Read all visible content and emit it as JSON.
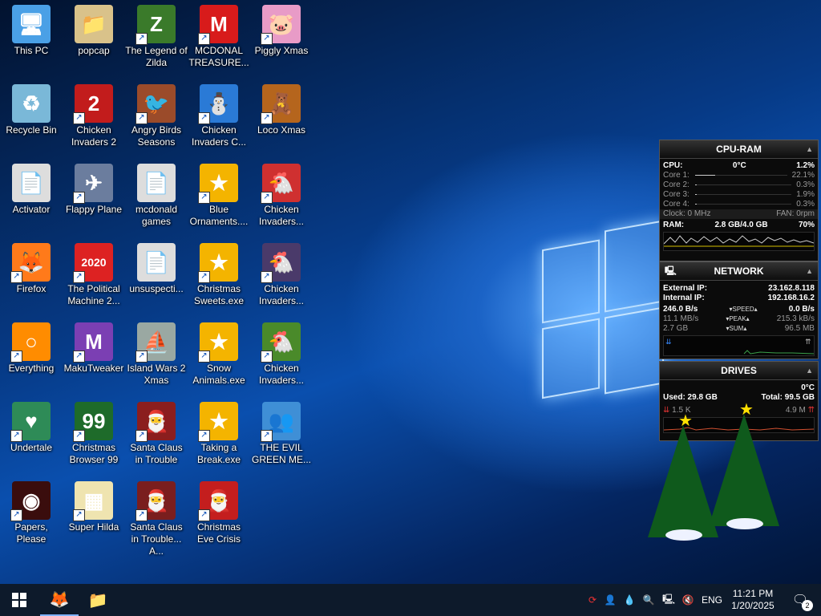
{
  "desktop_icons": [
    {
      "label": "This PC",
      "glyph": "🖥",
      "bg": "#4aa0e6",
      "shortcut": false
    },
    {
      "label": "popcap",
      "glyph": "📁",
      "bg": "#d9c28a",
      "shortcut": false
    },
    {
      "label": "The Legend of Zilda",
      "glyph": "Z",
      "bg": "#3a7a2a",
      "shortcut": true
    },
    {
      "label": "MCDONAL TREASURE...",
      "glyph": "M",
      "bg": "#d81b1b",
      "shortcut": true
    },
    {
      "label": "Piggly Xmas",
      "glyph": "🐷",
      "bg": "#e89bc7",
      "shortcut": true
    },
    {
      "label": "Recycle Bin",
      "glyph": "♻",
      "bg": "#7ab8d8",
      "shortcut": false
    },
    {
      "label": "Chicken Invaders 2",
      "glyph": "2",
      "bg": "#c21c1c",
      "shortcut": true
    },
    {
      "label": "Angry Birds Seasons",
      "glyph": "🐦",
      "bg": "#9b4b2a",
      "shortcut": true
    },
    {
      "label": "Chicken Invaders C...",
      "glyph": "⛄",
      "bg": "#2a7ad6",
      "shortcut": true
    },
    {
      "label": "Loco Xmas",
      "glyph": "🧸",
      "bg": "#b5651d",
      "shortcut": true
    },
    {
      "label": "Activator",
      "glyph": "📄",
      "bg": "#dddddd",
      "shortcut": false
    },
    {
      "label": "Flappy Plane",
      "glyph": "✈",
      "bg": "#6b7d9e",
      "shortcut": true
    },
    {
      "label": "mcdonald games",
      "glyph": "📄",
      "bg": "#dddddd",
      "shortcut": false
    },
    {
      "label": "Blue Ornaments....",
      "glyph": "★",
      "bg": "#f4b400",
      "shortcut": true
    },
    {
      "label": "Chicken Invaders...",
      "glyph": "🐔",
      "bg": "#cf3030",
      "shortcut": true
    },
    {
      "label": "Firefox",
      "glyph": "🦊",
      "bg": "#ff7a1a",
      "shortcut": true
    },
    {
      "label": "The Political Machine 2...",
      "glyph": "2020",
      "bg": "#d22",
      "shortcut": true
    },
    {
      "label": "unsuspecti...",
      "glyph": "📄",
      "bg": "#dddddd",
      "shortcut": false
    },
    {
      "label": "Christmas Sweets.exe",
      "glyph": "★",
      "bg": "#f4b400",
      "shortcut": true
    },
    {
      "label": "Chicken Invaders...",
      "glyph": "🐔",
      "bg": "#4a3a6a",
      "shortcut": true
    },
    {
      "label": "Everything",
      "glyph": "○",
      "bg": "#ff8c00",
      "shortcut": true
    },
    {
      "label": "MakuTweaker",
      "glyph": "M",
      "bg": "#7b3fb3",
      "shortcut": true
    },
    {
      "label": "Island Wars 2 Xmas",
      "glyph": "⛵",
      "bg": "#9aa8a2",
      "shortcut": true
    },
    {
      "label": "Snow Animals.exe",
      "glyph": "★",
      "bg": "#f4b400",
      "shortcut": true
    },
    {
      "label": "Chicken Invaders...",
      "glyph": "🐔",
      "bg": "#4a8a2a",
      "shortcut": true
    },
    {
      "label": "Undertale",
      "glyph": "♥",
      "bg": "#2e8b57",
      "shortcut": true
    },
    {
      "label": "Christmas Browser 99",
      "glyph": "99",
      "bg": "#1e6b2a",
      "shortcut": true
    },
    {
      "label": "Santa Claus in Trouble",
      "glyph": "🎅",
      "bg": "#8b1e1e",
      "shortcut": true
    },
    {
      "label": "Taking a Break.exe",
      "glyph": "★",
      "bg": "#f4b400",
      "shortcut": true
    },
    {
      "label": "THE EVIL GREEN ME...",
      "glyph": "👥",
      "bg": "#3f8fd6",
      "shortcut": true
    },
    {
      "label": "Papers, Please",
      "glyph": "◉",
      "bg": "#3a0d0d",
      "shortcut": true
    },
    {
      "label": "Super Hilda",
      "glyph": "▦",
      "bg": "#efe4b0",
      "shortcut": true
    },
    {
      "label": "Santa Claus in Trouble... A...",
      "glyph": "🎅",
      "bg": "#7a1e1e",
      "shortcut": true
    },
    {
      "label": "Christmas Eve Crisis",
      "glyph": "🎅",
      "bg": "#c41e1e",
      "shortcut": true
    }
  ],
  "cpu_gadget": {
    "title": "CPU-RAM",
    "cpu_label": "CPU:",
    "cpu_temp": "0°C",
    "cpu_usage": "1.2%",
    "cores": [
      {
        "label": "Core 1:",
        "value": "22.1%",
        "level": 0.22
      },
      {
        "label": "Core 2:",
        "value": "0.3%",
        "level": 0.003
      },
      {
        "label": "Core 3:",
        "value": "1.9%",
        "level": 0.02
      },
      {
        "label": "Core 4:",
        "value": "0.3%",
        "level": 0.003
      }
    ],
    "clock": "Clock: 0 MHz",
    "fan": "FAN: 0rpm",
    "ram_label": "RAM:",
    "ram_used": "2.8 GB/4.0 GB",
    "ram_pct": "70%"
  },
  "network_gadget": {
    "title": "NETWORK",
    "external_label": "External IP:",
    "external_ip": "23.162.8.118",
    "internal_label": "Internal IP:",
    "internal_ip": "192.168.16.2",
    "speed_left": "246.0 B/s",
    "speed_label": "SPEED",
    "speed_right": "0.0 B/s",
    "peak_left": "11.1 MB/s",
    "peak_label": "PEAK",
    "peak_right": "215.3 kB/s",
    "sum_left": "2.7 GB",
    "sum_label": "SUM",
    "sum_right": "96.5 MB"
  },
  "drives_gadget": {
    "title": "DRIVES",
    "temp": "0°C",
    "used": "Used: 29.8 GB",
    "total": "Total: 99.5 GB",
    "read": "1.5 K",
    "write": "4.9 M"
  },
  "taskbar": {
    "pinned": [
      {
        "name": "firefox",
        "glyph": "🦊"
      },
      {
        "name": "file-explorer",
        "glyph": "📁"
      }
    ],
    "language": "ENG",
    "time": "11:21 PM",
    "date": "1/20/2025",
    "notifications": "2"
  }
}
